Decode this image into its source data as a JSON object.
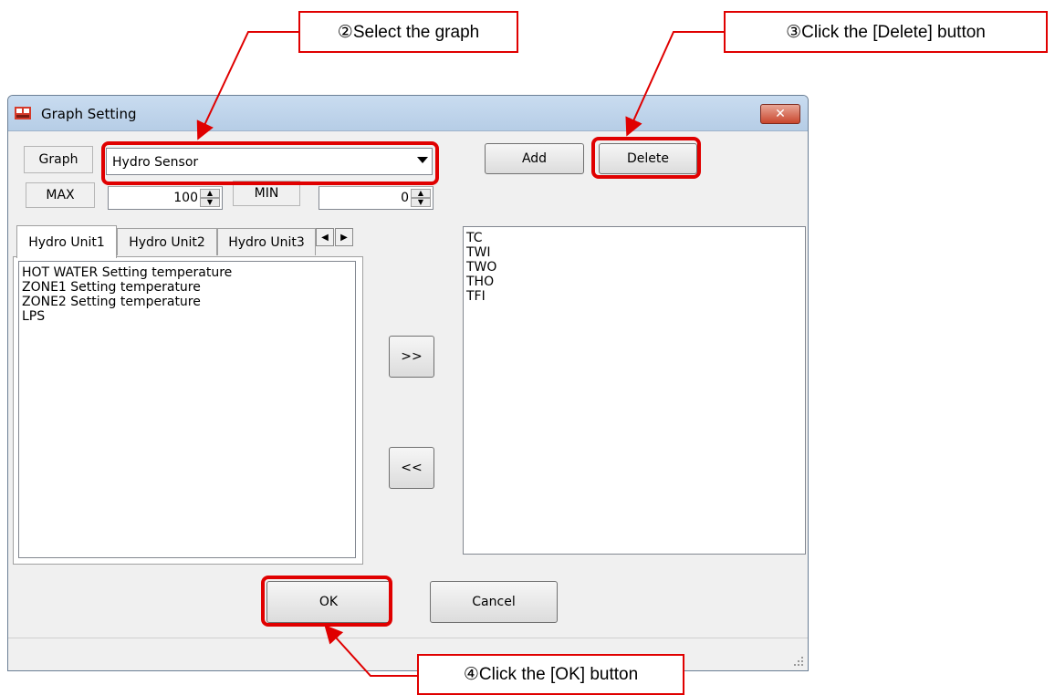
{
  "window": {
    "title": "Graph Setting",
    "close_glyph": "✕"
  },
  "graph": {
    "label": "Graph",
    "selected": "Hydro Sensor",
    "max_label": "MAX",
    "max_value": "100",
    "min_label": "MIN",
    "min_value": "0"
  },
  "buttons": {
    "add": "Add",
    "delete": "Delete",
    "move_right": ">>",
    "move_left": "<<",
    "ok": "OK",
    "cancel": "Cancel"
  },
  "tabs": [
    "Hydro Unit1",
    "Hydro Unit2",
    "Hydro Unit3"
  ],
  "tab_scroll": {
    "left": "◀",
    "right": "▶"
  },
  "available_items": [
    "HOT WATER Setting temperature",
    "ZONE1 Setting temperature",
    "ZONE2 Setting temperature",
    "LPS"
  ],
  "selected_items": [
    "TC",
    "TWI",
    "TWO",
    "THO",
    "TFI"
  ],
  "annotations": {
    "step2": "②Select the graph",
    "step3": "③Click the [Delete] button",
    "step4": "④Click the [OK] button"
  },
  "colors": {
    "accent": "#e00000"
  }
}
